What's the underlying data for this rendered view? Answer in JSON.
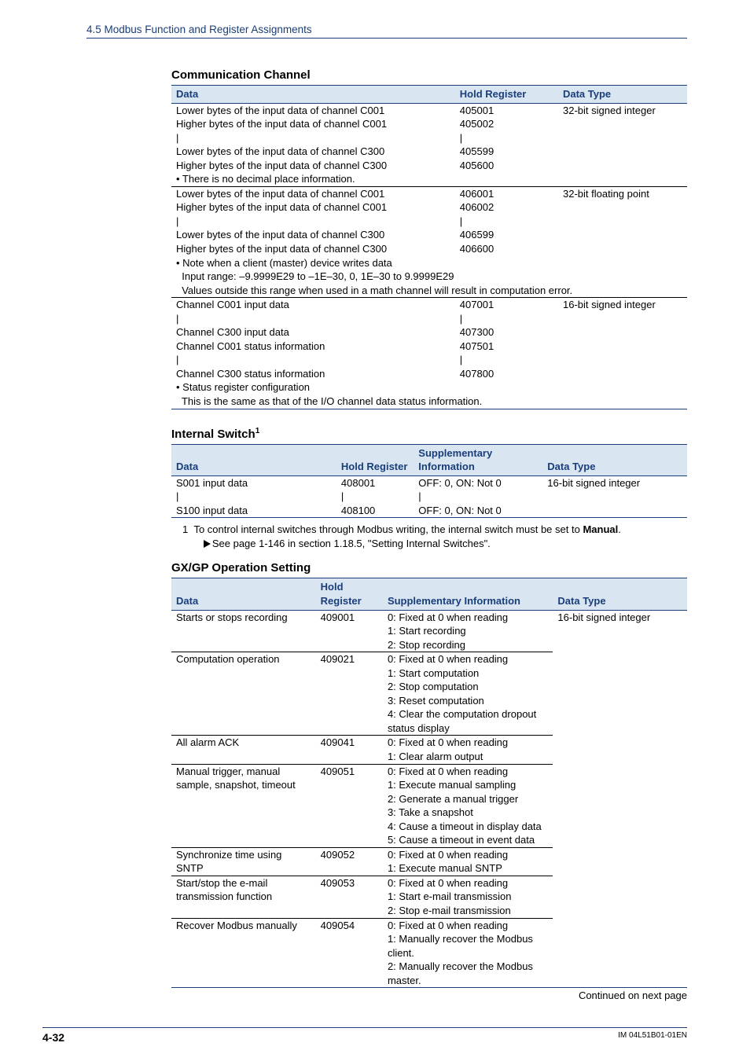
{
  "header": {
    "section_path": "4.5  Modbus Function and Register Assignments"
  },
  "t1": {
    "title": "Communication Channel",
    "cols": {
      "data": "Data",
      "reg": "Hold Register",
      "type": "Data Type"
    },
    "g1": {
      "r1": {
        "d": "Lower bytes of the input data of channel C001",
        "r": "405001",
        "t": "32-bit signed integer"
      },
      "r2": {
        "d": "Higher bytes of the input data of channel C001",
        "r": "405002"
      },
      "r3": {
        "d": "Lower bytes of the input data of channel C300",
        "r": "405599"
      },
      "r4": {
        "d": "Higher bytes of the input data of channel C300",
        "r": "405600"
      },
      "r5": {
        "d": "• There is no decimal place information."
      }
    },
    "g2": {
      "r1": {
        "d": "Lower bytes of the input data of channel C001",
        "r": "406001",
        "t": "32-bit floating point"
      },
      "r2": {
        "d": "Higher bytes of the input data of channel C001",
        "r": "406002"
      },
      "r3": {
        "d": "Lower bytes of the input data of channel C300",
        "r": "406599"
      },
      "r4": {
        "d": "Higher bytes of the input data of channel C300",
        "r": "406600"
      },
      "r5": {
        "d": "• Note when a client (master) device writes data"
      },
      "r6": {
        "d": "  Input range: –9.9999E29 to –1E–30, 0, 1E–30 to 9.9999E29"
      },
      "r7": {
        "d": "  Values outside this range when used in a math channel will result in computation error."
      }
    },
    "g3": {
      "r1": {
        "d": "Channel C001 input data",
        "r": "407001",
        "t": "16-bit signed integer"
      },
      "r2": {
        "d": "Channel C300 input data",
        "r": "407300"
      },
      "r3": {
        "d": "Channel C001 status information",
        "r": "407501"
      },
      "r4": {
        "d": "Channel C300 status information",
        "r": "407800"
      },
      "r5": {
        "d": "• Status register configuration"
      },
      "r6": {
        "d": "  This is the same as that of the I/O channel data status information."
      }
    }
  },
  "t2": {
    "title_pre": "Internal Switch",
    "title_sup": "1",
    "cols": {
      "data": "Data",
      "reg": "Hold Register",
      "sup": "Supplementary Information",
      "type": "Data Type"
    },
    "r1": {
      "d": "S001 input data",
      "r": "408001",
      "s": "OFF: 0, ON: Not 0",
      "t": "16-bit signed integer"
    },
    "r2": {
      "d": "S100 input data",
      "r": "408100",
      "s": "OFF: 0, ON: Not 0"
    },
    "note_num": "1",
    "note_line1": "To control internal switches through Modbus writing, the internal switch must be set to ",
    "note_bold": "Manual",
    "note_dot": ".",
    "note_line2": "See page 1-146 in section 1.18.5, \"Setting Internal Switches\"."
  },
  "t3": {
    "title": "GX/GP Operation Setting",
    "cols": {
      "data": "Data",
      "reg": "Hold Register",
      "sup": "Supplementary Information",
      "type": "Data Type"
    },
    "r1": {
      "d": "Starts or stops recording",
      "r": "409001",
      "s1": "0: Fixed at 0 when reading",
      "s2": "1: Start recording",
      "s3": "2: Stop recording",
      "t": "16-bit signed integer"
    },
    "r2": {
      "d": "Computation operation",
      "r": "409021",
      "s1": "0: Fixed at 0 when reading",
      "s2": "1: Start computation",
      "s3": "2: Stop computation",
      "s4": "3: Reset computation",
      "s5": "4: Clear the computation dropout status display"
    },
    "r3": {
      "d": "All alarm ACK",
      "r": "409041",
      "s1": "0: Fixed at 0 when reading",
      "s2": "1: Clear alarm output"
    },
    "r4": {
      "d": "Manual trigger, manual sample, snapshot, timeout",
      "r": "409051",
      "s1": "0: Fixed at 0 when reading",
      "s2": "1: Execute manual sampling",
      "s3": "2: Generate a manual trigger",
      "s4": "3: Take a snapshot",
      "s5": "4: Cause a timeout in display data",
      "s6": "5: Cause a timeout in event data"
    },
    "r5": {
      "d": "Synchronize time using SNTP",
      "r": "409052",
      "s1": "0: Fixed at 0 when reading",
      "s2": "1: Execute manual SNTP"
    },
    "r6": {
      "d": "Start/stop the e-mail transmission function",
      "r": "409053",
      "s1": "0: Fixed at 0 when reading",
      "s2": "1: Start e-mail transmission",
      "s3": "2: Stop e-mail transmission"
    },
    "r7": {
      "d": "Recover Modbus manually",
      "r": "409054",
      "s1": "0: Fixed at 0 when reading",
      "s2": "1: Manually recover the Modbus client.",
      "s3": "2: Manually recover the Modbus master."
    },
    "continued": "Continued on next page"
  },
  "footer": {
    "page": "4-32",
    "doc": "IM 04L51B01-01EN"
  }
}
